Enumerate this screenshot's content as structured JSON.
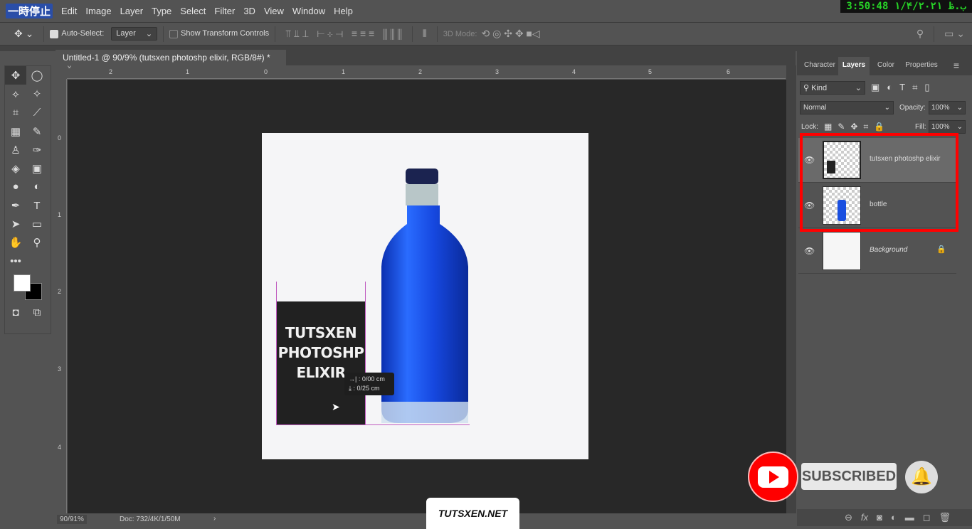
{
  "app": {
    "logo_text": "一時停止",
    "menus": [
      "Edit",
      "Image",
      "Layer",
      "Type",
      "Select",
      "Filter",
      "3D",
      "View",
      "Window",
      "Help"
    ],
    "clock": "3:50:48 ۱/۴/۲۰۲۱ ب.ظ"
  },
  "options": {
    "auto_select_label": "Auto-Select:",
    "auto_select_checked": true,
    "auto_select_value": "Layer",
    "show_transform_label": "Show Transform Controls",
    "show_transform_checked": false,
    "mode3d_label": "3D Mode:"
  },
  "document": {
    "tab_title": "Untitled-1 @ 90/9% (tutsxen photoshp elixir, RGB/8#) *",
    "text_lines": [
      "TUTSXEN",
      "PHOTOSHP",
      "ELIXIR"
    ],
    "tooltip": {
      "x": "0/00 cm",
      "y": "0/25 cm"
    },
    "hruler": [
      "2",
      "1",
      "0",
      "1",
      "2",
      "3",
      "4",
      "5",
      "6"
    ],
    "vruler": [
      "0",
      "1",
      "2",
      "3",
      "4"
    ]
  },
  "status": {
    "zoom": "90/91%",
    "doc": "Doc: 732/4K/1/50M"
  },
  "panel": {
    "tabs": [
      "Character",
      "Layers",
      "Color",
      "Properties"
    ],
    "active_tab": "Layers",
    "filter": "Kind",
    "blend_mode": "Normal",
    "opacity_label": "Opacity:",
    "opacity": "100%",
    "lock_label": "Lock:",
    "fill_label": "Fill:",
    "fill": "100%",
    "layers": [
      {
        "name": "tutsxen photoshp elixir",
        "selected": true,
        "visible": true
      },
      {
        "name": "bottle",
        "selected": false,
        "visible": true
      },
      {
        "name": "Background",
        "selected": false,
        "visible": true,
        "locked": true
      }
    ]
  },
  "overlay": {
    "watermark": "TUTSXEN.NET",
    "subscribed": "SUBSCRIBED"
  },
  "colors": {
    "highlight": "#ff0000",
    "bottle": "#1a4fe0",
    "youtube": "#ff0000"
  }
}
